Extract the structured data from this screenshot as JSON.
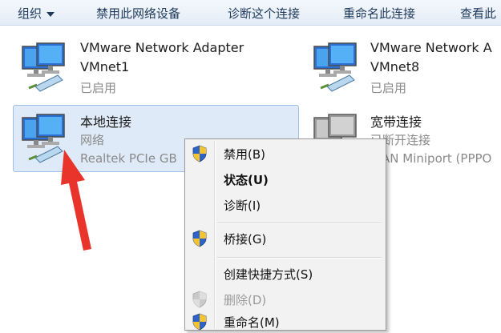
{
  "toolbar": {
    "organize": "组织",
    "disable_device": "禁用此网络设备",
    "diagnose": "诊断这个连接",
    "rename": "重命名此连接",
    "view": "查看此"
  },
  "adapters": [
    {
      "name": "VMware Network Adapter",
      "line2": "VMnet1",
      "status": "已启用"
    },
    {
      "name": "VMware Network A",
      "line2": "VMnet8",
      "status": "已启用"
    },
    {
      "name": "本地连接",
      "line2": "网络",
      "status": "Realtek PCIe GB"
    },
    {
      "name": "宽带连接",
      "line2": "已断开连接",
      "status": "WAN Miniport (PPPO"
    }
  ],
  "context_menu": {
    "items": [
      {
        "label": "禁用(B)"
      },
      {
        "label": "状态(U)"
      },
      {
        "label": "诊断(I)"
      },
      {
        "label": "桥接(G)"
      },
      {
        "label": "创建快捷方式(S)"
      },
      {
        "label": "删除(D)"
      },
      {
        "label": "重命名(M)"
      }
    ]
  },
  "colors": {
    "toolbar_text": "#1e395b",
    "selection_bg": "#dfeaf8",
    "arrow_red": "#e8342a"
  }
}
